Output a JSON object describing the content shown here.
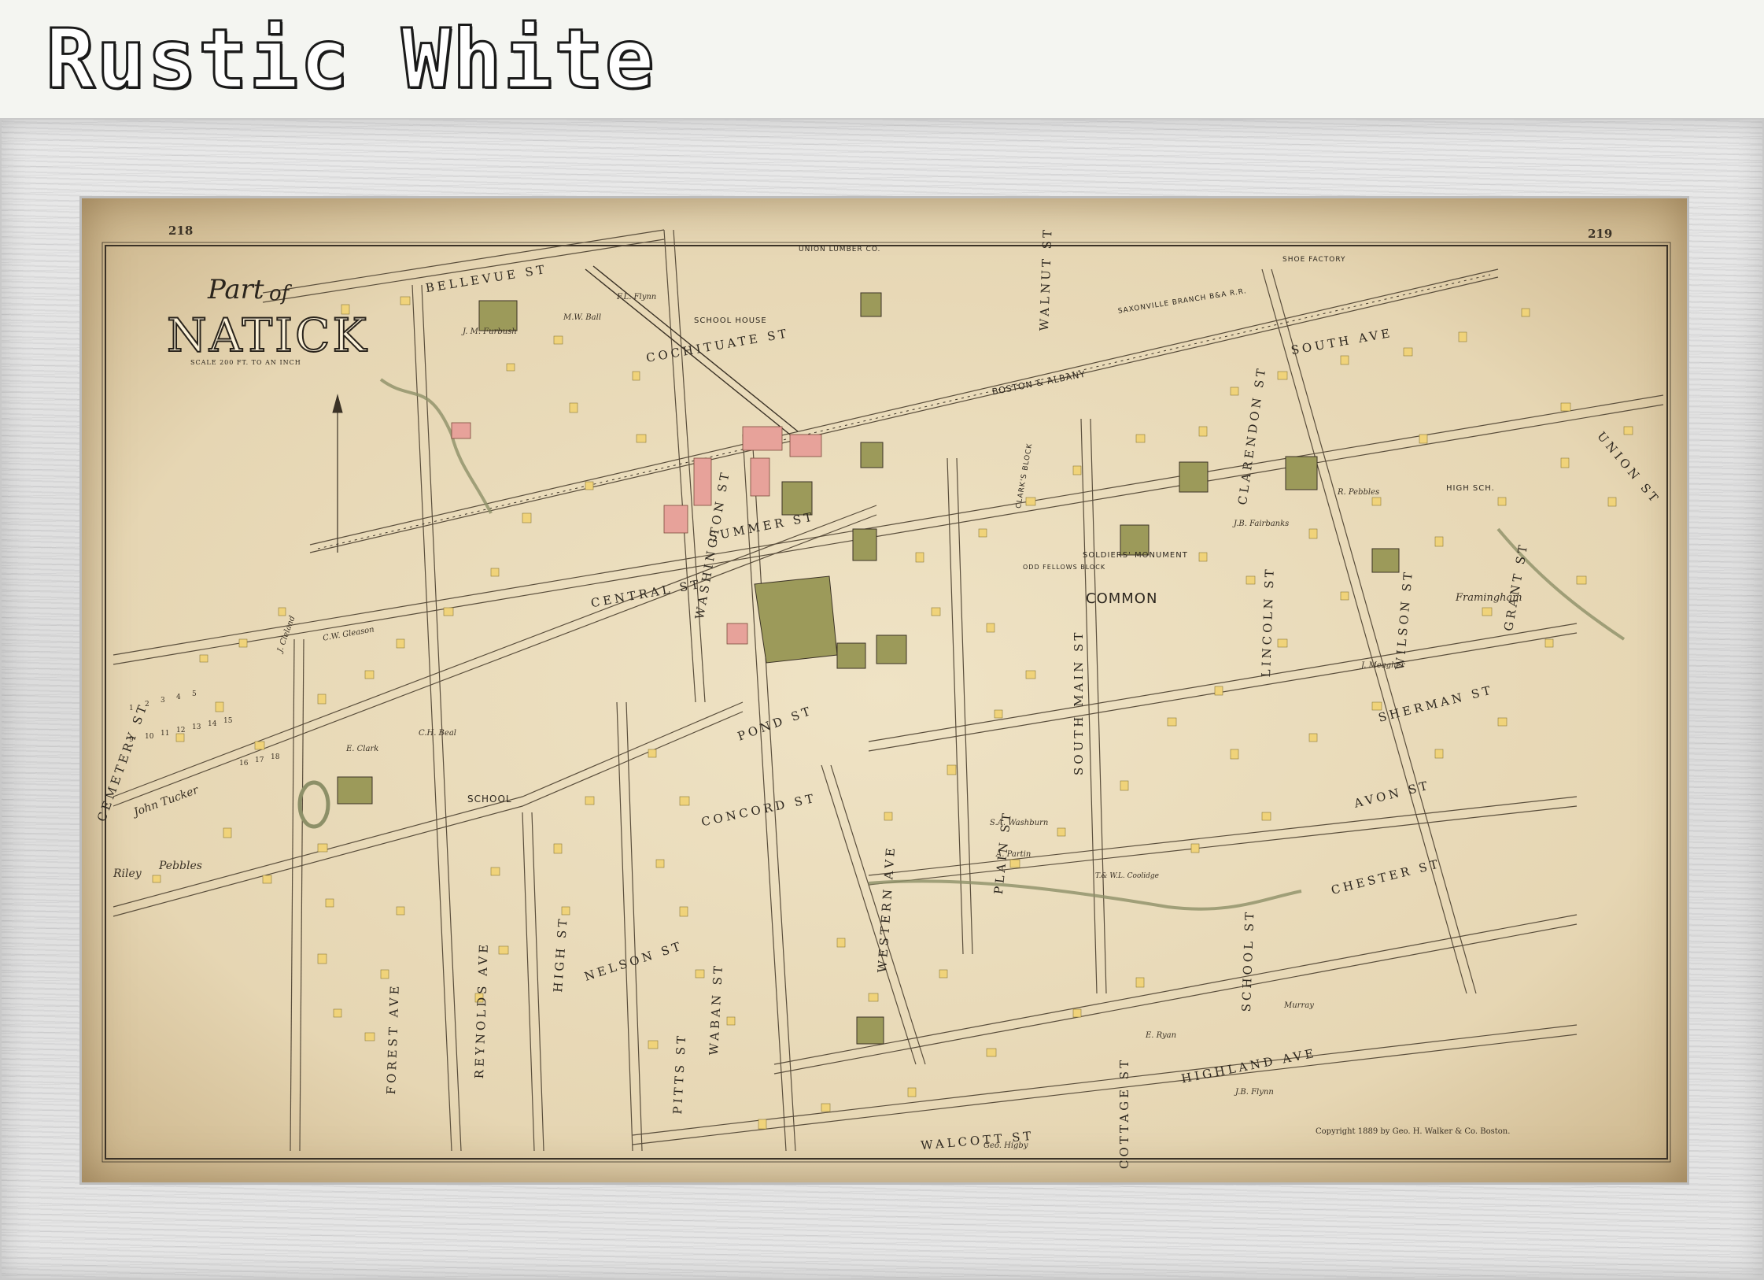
{
  "banner": {
    "title": "Rustic White"
  },
  "map": {
    "page_left": "218",
    "page_right": "219",
    "title_part": "Part",
    "title_of": "of",
    "title_town": "NATICK",
    "title_scale": "SCALE 200 FT. TO AN INCH",
    "copyright": "Copyright 1889 by Geo. H. Walker & Co. Boston.",
    "colors": {
      "brick": "#e7a29a",
      "wood": "#f0d37a",
      "public": "#9c9a5a",
      "paper": "#efe3c5",
      "frame": "#e3e3e3"
    },
    "streets": [
      {
        "id": "bellevue",
        "text": "BELLEVUE",
        "suffix": "ST"
      },
      {
        "id": "cochituate",
        "text": "COCHITUATE",
        "suffix": "ST"
      },
      {
        "id": "summer",
        "text": "SUMMER",
        "suffix": "ST"
      },
      {
        "id": "central",
        "text": "CENTRAL",
        "suffix": "ST"
      },
      {
        "id": "pond",
        "text": "POND",
        "suffix": "ST"
      },
      {
        "id": "concord",
        "text": "CONCORD",
        "suffix": "ST"
      },
      {
        "id": "nelson",
        "text": "NELSON",
        "suffix": "ST"
      },
      {
        "id": "forest",
        "text": "FOREST",
        "suffix": "AVE"
      },
      {
        "id": "reynolds",
        "text": "REYNOLDS",
        "suffix": "AVE"
      },
      {
        "id": "high",
        "text": "HIGH",
        "suffix": "ST"
      },
      {
        "id": "waban",
        "text": "WABAN",
        "suffix": "ST"
      },
      {
        "id": "pitts",
        "text": "PITTS",
        "suffix": "ST"
      },
      {
        "id": "western",
        "text": "WESTERN",
        "suffix": "AVE"
      },
      {
        "id": "plain",
        "text": "PLAIN",
        "suffix": "ST"
      },
      {
        "id": "walcott",
        "text": "WALCOTT",
        "suffix": "ST"
      },
      {
        "id": "south-main",
        "text": "SOUTH MAIN",
        "suffix": "ST"
      },
      {
        "id": "highland",
        "text": "HIGHLAND",
        "suffix": "AVE"
      },
      {
        "id": "cottage",
        "text": "COTTAGE",
        "suffix": "ST"
      },
      {
        "id": "school",
        "text": "SCHOOL",
        "suffix": "ST"
      },
      {
        "id": "sherman",
        "text": "SHERMAN",
        "suffix": "ST"
      },
      {
        "id": "avon",
        "text": "AVON",
        "suffix": "ST"
      },
      {
        "id": "chester",
        "text": "CHESTER",
        "suffix": "ST"
      },
      {
        "id": "lincoln",
        "text": "LINCOLN",
        "suffix": "ST"
      },
      {
        "id": "wilson",
        "text": "WILSON",
        "suffix": "ST"
      },
      {
        "id": "grant",
        "text": "GRANT",
        "suffix": "ST"
      },
      {
        "id": "south-ave",
        "text": "SOUTH",
        "suffix": "AVE"
      },
      {
        "id": "union",
        "text": "UNION",
        "suffix": "ST"
      },
      {
        "id": "washington",
        "text": "WASHINGTON",
        "suffix": "ST"
      },
      {
        "id": "clarendon",
        "text": "CLARENDON",
        "suffix": "ST"
      },
      {
        "id": "walnut",
        "text": "WALNUT",
        "suffix": "ST"
      },
      {
        "id": "cemetery",
        "text": "CEMETERY",
        "suffix": "ST"
      }
    ],
    "landmarks": {
      "common": "COMMON",
      "soldiers_monument": "SOLDIERS' MONUMENT",
      "school_house": "SCHOOL HOUSE",
      "school": "SCHOOL",
      "high_school": "HIGH SCH.",
      "railroad": "BOSTON & ALBANY",
      "saxonville": "SAXONVILLE BRANCH B&A R.R.",
      "shoe_factory": "SHOE FACTORY",
      "union_lumber": "UNION LUMBER CO.",
      "clarks_block": "CLARK'S BLOCK",
      "odd_fellows": "ODD FELLOWS BLOCK"
    },
    "owners": [
      {
        "text": "J. M. Furbush"
      },
      {
        "text": "M.W. Ball"
      },
      {
        "text": "F.L. Flynn"
      },
      {
        "text": "C.W. Gleason"
      },
      {
        "text": "J. Cleland"
      },
      {
        "text": "E. Clark"
      },
      {
        "text": "C.H. Beal"
      },
      {
        "text": "John Tucker"
      },
      {
        "text": "Riley"
      },
      {
        "text": "Pebbles"
      },
      {
        "text": "J.B. Fairbanks"
      },
      {
        "text": "R. Pebbles"
      },
      {
        "text": "S.A. Washburn"
      },
      {
        "text": "A. Partin"
      },
      {
        "text": "T.& W.L. Coolidge"
      },
      {
        "text": "E. Ryan"
      },
      {
        "text": "J.B. Flynn"
      },
      {
        "text": "Geo. Higby"
      },
      {
        "text": "J. Meagher"
      },
      {
        "text": "Murray"
      },
      {
        "text": "Framingham"
      }
    ]
  }
}
